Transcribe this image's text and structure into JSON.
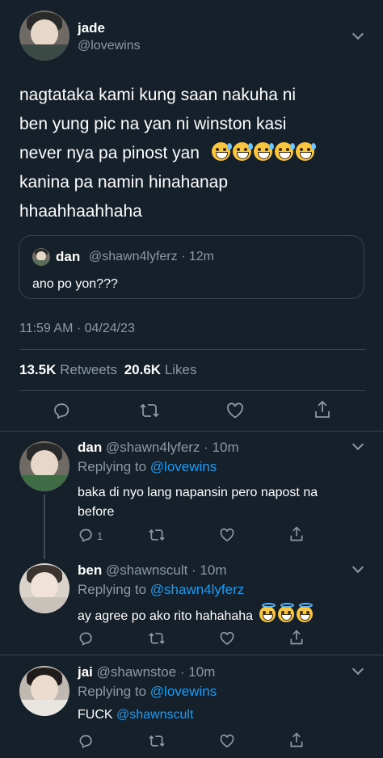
{
  "main_tweet": {
    "name": "jade",
    "handle": "@lovewins",
    "text_lines": [
      "nagtataka kami kung saan nakuha ni",
      "ben yung pic na yan ni winston kasi",
      "never nya pa pinost yan",
      "kanina pa namin hinahanap",
      "hhaahhaahhaha"
    ],
    "emoji_name": "grinning-face-with-sweat",
    "emoji_count": 5,
    "quoted": {
      "name": "dan",
      "handle_time": "@shawn4lyferz · 12m",
      "text": "ano po yon???"
    },
    "timestamp": "11:59 AM · 04/24/23",
    "retweets_count": "13.5K",
    "retweets_label": "Retweets",
    "likes_count": "20.6K",
    "likes_label": "Likes"
  },
  "replies": [
    {
      "name": "dan",
      "handle_time": "@shawn4lyferz · 10m",
      "replying_prefix": "Replying to",
      "replying_to": "@lovewins",
      "text_lines": [
        "baka di nyo lang napansin pero napost na",
        "before"
      ],
      "reply_count": "1"
    },
    {
      "name": "ben",
      "handle_time": "@shawnscult · 10m",
      "replying_prefix": "Replying to",
      "replying_to": "@shawn4lyferz",
      "text": "ay agree po ako rito hahahaha",
      "emoji_name": "smiling-face-with-halo",
      "emoji_count": 3
    },
    {
      "name": "jai",
      "handle_time": "@shawnstoe · 10m",
      "replying_prefix": "Replying to",
      "replying_to": "@lovewins",
      "text_prefix": "FUCK",
      "mention": "@shawnscult"
    }
  ],
  "colors": {
    "background": "#15202b",
    "text": "#ffffff",
    "muted": "#8b98a5",
    "link": "#1d9bf0",
    "border": "#38444d"
  }
}
